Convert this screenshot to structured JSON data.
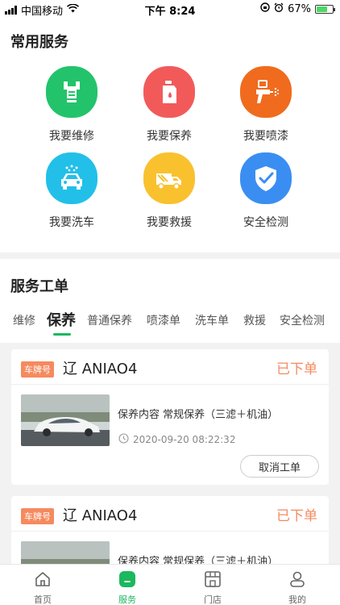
{
  "status_bar": {
    "carrier": "中国移动",
    "time": "下午 8:24",
    "battery": "67%",
    "battery_level": 0.67
  },
  "services": {
    "title": "常用服务",
    "items": [
      {
        "label": "我要维修",
        "icon": "wrench-icon",
        "color": "#23c36b"
      },
      {
        "label": "我要保养",
        "icon": "oil-can-icon",
        "color": "#f25a5a"
      },
      {
        "label": "我要喷漆",
        "icon": "spray-gun-icon",
        "color": "#f06b1e"
      },
      {
        "label": "我要洗车",
        "icon": "car-wash-icon",
        "color": "#22c0e8"
      },
      {
        "label": "我要救援",
        "icon": "tow-truck-icon",
        "color": "#f9c12e"
      },
      {
        "label": "安全检测",
        "icon": "shield-check-icon",
        "color": "#3a8ef2"
      }
    ]
  },
  "orders": {
    "title": "服务工单",
    "tabs": [
      "维修",
      "保养",
      "普通保养",
      "喷漆单",
      "洗车单",
      "救援",
      "安全检测"
    ],
    "active_tab": "保养",
    "cards": [
      {
        "plate_tag": "车牌号",
        "plate_no": "辽 ANIAO4",
        "status": "已下单",
        "content": "保养内容 常规保养（三滤＋机油）",
        "time": "2020-09-20 08:22:32",
        "cancel_label": "取消工单"
      },
      {
        "plate_tag": "车牌号",
        "plate_no": "辽 ANIAO4",
        "status": "已下单",
        "content": "保养内容 常规保养（三滤＋机油）"
      }
    ]
  },
  "tabbar": {
    "items": [
      {
        "label": "首页",
        "icon": "home-icon"
      },
      {
        "label": "服务",
        "icon": "service-icon"
      },
      {
        "label": "门店",
        "icon": "store-icon"
      },
      {
        "label": "我的",
        "icon": "profile-icon"
      }
    ],
    "active": "服务"
  },
  "colors": {
    "accent": "#1bb85e",
    "status_orange": "#f58a5f"
  }
}
